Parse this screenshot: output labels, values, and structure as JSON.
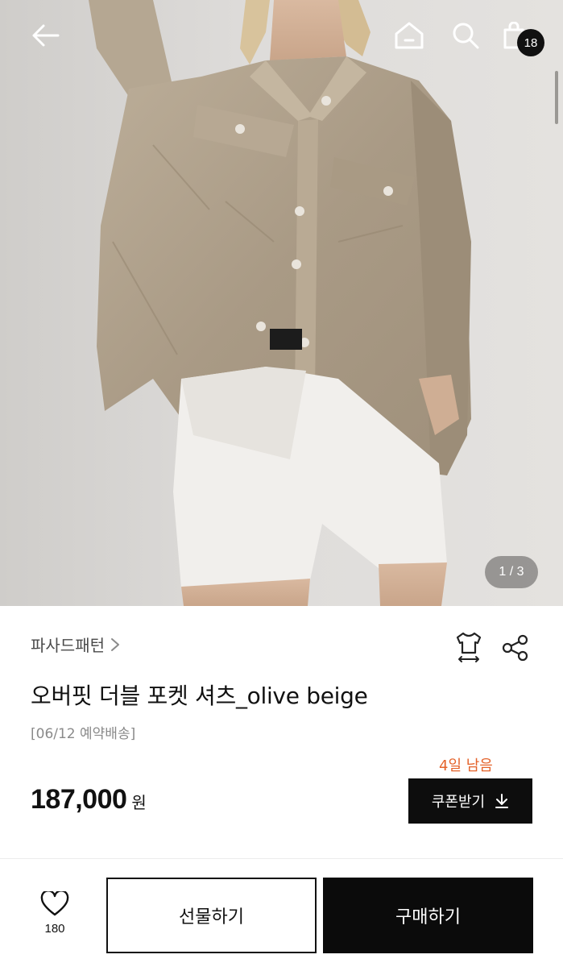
{
  "topbar": {
    "icons": [
      "back-arrow-icon",
      "home-icon",
      "search-icon",
      "shopping-bag-icon"
    ],
    "cart_count": "18"
  },
  "gallery": {
    "pager": "1 / 3"
  },
  "product": {
    "brand": "파사드패턴",
    "title": "오버핏 더블 포켓 셔츠_olive beige",
    "shipping_note": "[06/12 예약배송]",
    "countdown": "4일 남음",
    "price": "187,000",
    "currency": "원",
    "coupon_label": "쿠폰받기"
  },
  "bottom_bar": {
    "like_count": "180",
    "gift_label": "선물하기",
    "buy_label": "구매하기"
  },
  "colors": {
    "accent_orange": "#e4632b",
    "black": "#0b0b0b",
    "shirt_beige": "#b0a18c"
  }
}
